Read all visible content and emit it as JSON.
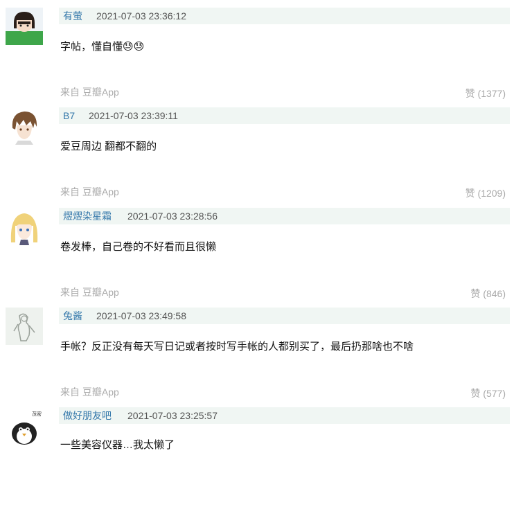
{
  "comments": [
    {
      "author": "有萤",
      "time": "2021-07-03 23:36:12",
      "content": "字帖，懂自懂😓😓",
      "source": "来自 豆瓣App",
      "likes": "赞 (1377)",
      "avatar_icon": "girl-green-shirt-avatar-icon"
    },
    {
      "author": "B7",
      "time": "2021-07-03 23:39:11",
      "content": "爱豆周边 翻都不翻的",
      "source": "来自 豆瓣App",
      "likes": "赞 (1209)",
      "avatar_icon": "anime-boy-avatar-icon"
    },
    {
      "author": "熤熤染星霜",
      "time": "2021-07-03 23:28:56",
      "content": "卷发棒，自己卷的不好看而且很懒",
      "source": "来自 豆瓣App",
      "likes": "赞 (846)",
      "avatar_icon": "blonde-anime-girl-avatar-icon"
    },
    {
      "author": "兔酱",
      "time": "2021-07-03 23:49:58",
      "content": "手帐？反正没有每天写日记或者按时写手帐的人都别买了，最后扔那啥也不啥",
      "source": "来自 豆瓣App",
      "likes": "赞 (577)",
      "avatar_icon": "sketch-figure-avatar-icon"
    },
    {
      "author": "做好朋友吧",
      "time": "2021-07-03 23:25:57",
      "content": "一些美容仪器…我太懒了",
      "avatar_icon": "penguin-avatar-icon",
      "avatar_text": "茂密"
    }
  ],
  "colors": {
    "author": "#3377aa",
    "meta_bg": "#f0f6f3",
    "muted": "#aaaaaa"
  }
}
